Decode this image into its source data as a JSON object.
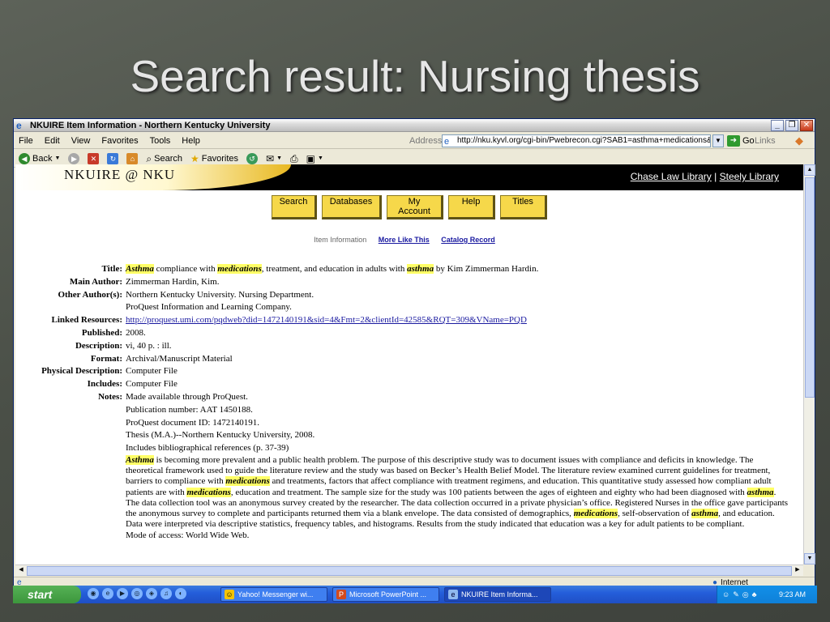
{
  "slide": {
    "title": "Search result: Nursing thesis"
  },
  "window": {
    "title": "NKUIRE Item Information - Northern Kentucky University"
  },
  "menu": [
    "File",
    "Edit",
    "View",
    "Favorites",
    "Tools",
    "Help"
  ],
  "address": {
    "label": "Address",
    "url": "http://nku.kyvl.org/cgi-bin/Pwebrecon.cgi?SAB1=asthma+medications&",
    "go": "Go",
    "links": "Links"
  },
  "toolbar": {
    "back": "Back",
    "search": "Search",
    "favorites": "Favorites"
  },
  "banner": {
    "logo": "NKUIRE @ NKU",
    "link1": "Chase Law Library",
    "sep": "|",
    "link2": "Steely Library"
  },
  "nav_buttons": [
    "Search",
    "Databases",
    "My Account",
    "Help",
    "Titles"
  ],
  "subnav": {
    "current": "Item Information",
    "more": "More Like This",
    "catalog": "Catalog Record"
  },
  "record": {
    "title_label": "Title:",
    "title_h1": "Asthma",
    "title_t1": " compliance with ",
    "title_h2": "medications",
    "title_t2": ", treatment, and education in adults with ",
    "title_h3": "asthma",
    "title_t3": " by Kim Zimmerman Hardin.",
    "main_author_label": "Main Author:",
    "main_author": "Zimmerman Hardin, Kim.",
    "other_authors_label": "Other Author(s):",
    "other_author_1": "Northern Kentucky University. Nursing Department.",
    "other_author_2": "ProQuest Information and Learning Company.",
    "linked_label": "Linked Resources:",
    "linked_url": "http://proquest.umi.com/pqdweb?did=1472140191&sid=4&Fmt=2&clientId=42585&RQT=309&VName=PQD",
    "published_label": "Published:",
    "published": "2008.",
    "description_label": "Description:",
    "description": "vi, 40 p. : ill.",
    "format_label": "Format:",
    "format": "Archival/Manuscript Material",
    "physical_label": "Physical Description:",
    "physical": "Computer File",
    "includes_label": "Includes:",
    "includes": "Computer File",
    "notes_label": "Notes:",
    "note_1": "Made available through ProQuest.",
    "note_2": "Publication number: AAT 1450188.",
    "note_3": "ProQuest document ID: 1472140191.",
    "note_4": "Thesis (M.A.)--Northern Kentucky University, 2008.",
    "note_5": "Includes bibliographical references (p. 37-39)",
    "abs_h1": "Asthma",
    "abs_t1": " is becoming more prevalent and a public health problem. The purpose of this descriptive study was to document issues with compliance and deficits in knowledge. The theoretical framework used to guide the literature review and the study was based on Becker’s Health Belief Model. The literature review examined current guidelines for treatment, barriers to compliance with ",
    "abs_h2": "medications",
    "abs_t2": " and treatments, factors that affect compliance with treatment regimens, and education. This quantitative study assessed how compliant adult patients are with ",
    "abs_h3": "medications",
    "abs_t3": ", education and treatment. The sample size for the study was 100 patients between the ages of eighteen and eighty who had been diagnosed with ",
    "abs_h4": "asthma",
    "abs_t4": ". The data collection tool was an anonymous survey created by the researcher. The data collection occurred in a private physician’s office. Registered Nurses in the office gave participants the anonymous survey to complete and participants returned them via a blank envelope. The data consisted of demographics, ",
    "abs_h5": "medications",
    "abs_t5": ", self-observation of ",
    "abs_h6": "asthma",
    "abs_t6": ", and education. Data were interpreted via descriptive statistics, frequency tables, and histograms. Results from the study indicated that education was a key for adult patients to be compliant.",
    "note_6": "Mode of access: World Wide Web."
  },
  "status": {
    "zone": "Internet"
  },
  "taskbar": {
    "start": "start",
    "task1": "Yahoo! Messenger wi...",
    "task2": "Microsoft PowerPoint ...",
    "task3": "NKUIRE Item Informa...",
    "clock": "9:23 AM"
  },
  "colors": {
    "highlight": "#ffff66",
    "button": "#f6d84a",
    "link": "#1a1aa0"
  }
}
